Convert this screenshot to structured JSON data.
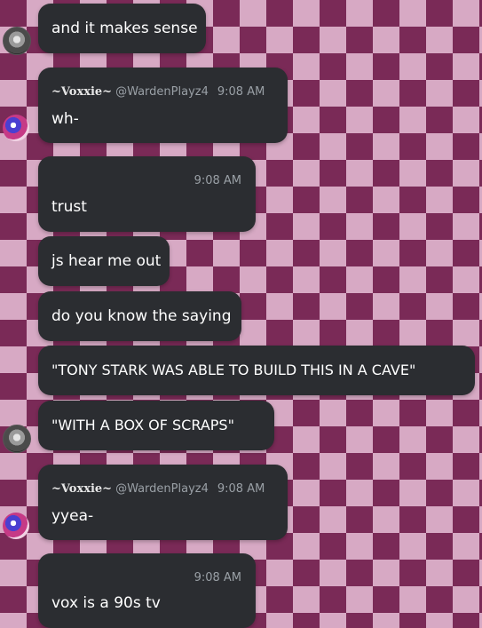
{
  "messages": [
    {
      "text": "and it makes sense"
    },
    {
      "author": "~Voxxie~",
      "handle": "@WardenPlayz4",
      "time": "9:08 AM",
      "text": "wh-"
    },
    {
      "time": "9:08 AM",
      "text": "trust"
    },
    {
      "text": "js hear me out"
    },
    {
      "text": "do you know the saying"
    },
    {
      "text": "\"TONY STARK WAS ABLE TO BUILD THIS IN A CAVE\""
    },
    {
      "text": "\"WITH A BOX OF SCRAPS\""
    },
    {
      "author": "~Voxxie~",
      "handle": "@WardenPlayz4",
      "time": "9:08 AM",
      "text": "yyea-"
    },
    {
      "time": "9:08 AM",
      "text": "vox is a 90s tv"
    }
  ],
  "avatars": {
    "gray": "gray-mask-avatar",
    "vox": "vox-avatar"
  },
  "colors": {
    "bubble": "#2b2d31",
    "checker_dark": "#7a2a57",
    "checker_light": "#d7a9c4"
  }
}
